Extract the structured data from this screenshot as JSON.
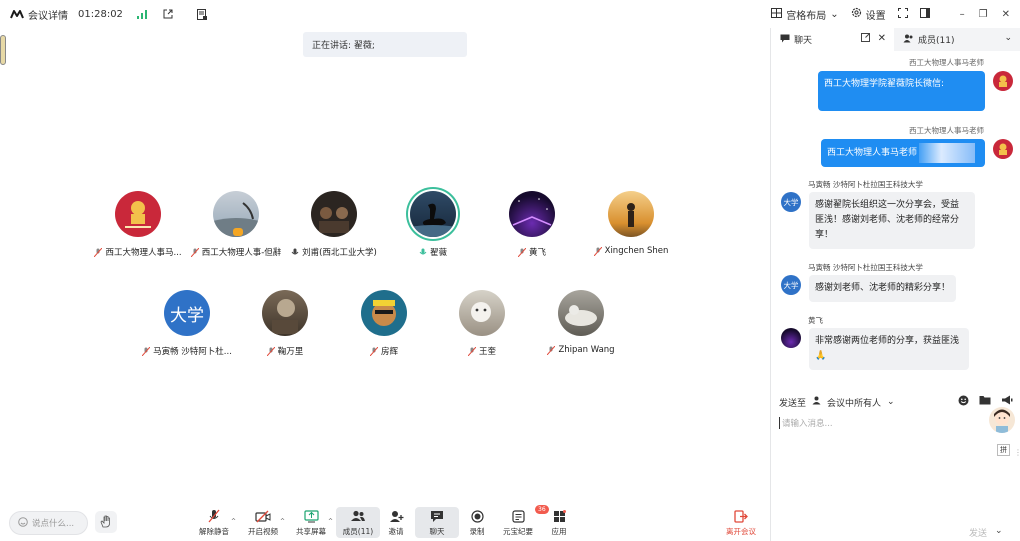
{
  "topbar": {
    "meeting_details": "会议详情",
    "elapsed": "01:28:02",
    "layout": "宫格布局",
    "settings": "设置"
  },
  "speaking": {
    "label": "正在讲话: 翟薇;"
  },
  "participants": [
    {
      "name": "西工大物理人事马..."
    },
    {
      "name": "西工大物理人事-但辭"
    },
    {
      "name": "刘甫(西北工业大学)"
    },
    {
      "name": "翟薇"
    },
    {
      "name": "黄飞"
    },
    {
      "name": "Xingchen Shen"
    },
    {
      "name": "马寅畅 沙特阿卜杜...",
      "avatar_text": "大学"
    },
    {
      "name": "鞠万里"
    },
    {
      "name": "房辉"
    },
    {
      "name": "王奎"
    },
    {
      "name": "Zhipan Wang"
    }
  ],
  "toolbar": {
    "say_placeholder": "说点什么...",
    "unmute": "解除静音",
    "video": "开启视频",
    "share": "共享屏幕",
    "members": "成员(11)",
    "invite": "邀请",
    "chat": "聊天",
    "record": "录制",
    "minutes": "元宝纪要",
    "minutes_badge": "36",
    "apps": "应用",
    "leave": "离开会议"
  },
  "panel": {
    "tab_chat": "聊天",
    "tab_members": "成员(11)",
    "messages": [
      {
        "sender": "西工大物理人事马老师",
        "text": "西工大物理学院翟薇院长微信:",
        "side": "right"
      },
      {
        "sender": "西工大物理人事马老师",
        "text": "西工大物理人事马老师",
        "side": "right"
      },
      {
        "sender": "马寅畅 沙特阿卜杜拉国王科技大学",
        "avatar_text": "大学",
        "lines": [
          "感谢翟院长组织这一次分享会，受益",
          "匪浅！感谢刘老师、沈老师的经常分",
          "享！"
        ],
        "side": "left"
      },
      {
        "sender": "马寅畅 沙特阿卜杜拉国王科技大学",
        "avatar_text": "大学",
        "lines": [
          "感谢刘老师、沈老师的精彩分享！"
        ],
        "side": "left"
      },
      {
        "sender": "黄飞",
        "lines": [
          "非常感谢两位老师的分享，获益匪浅",
          "🙏"
        ],
        "side": "left"
      }
    ],
    "send_to_label": "发送至",
    "send_to_value": "会议中所有人",
    "input_placeholder": "请输入消息...",
    "ime": "拼",
    "send": "发送"
  },
  "colors": {
    "accent": "#1f8df2",
    "speaking_ring": "#3cbf9c",
    "leave": "#e0493a"
  }
}
